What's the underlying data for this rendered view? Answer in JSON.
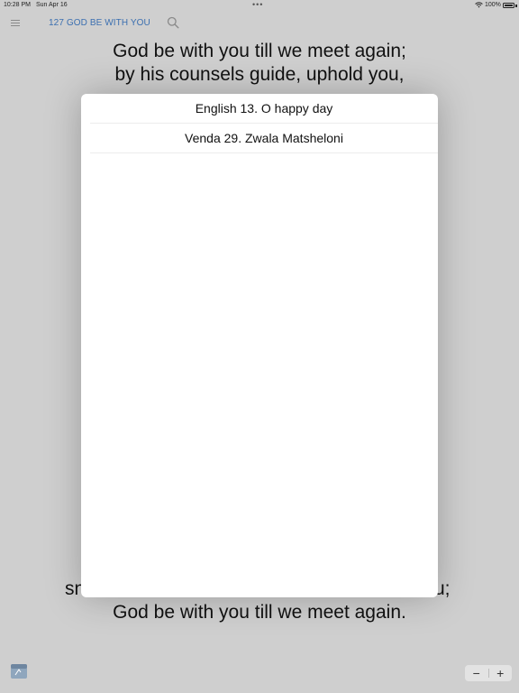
{
  "status": {
    "time": "10:28 PM",
    "date": "Sun Apr 16",
    "battery": "100%"
  },
  "nav": {
    "title": "127 GOD BE WITH YOU"
  },
  "hymn": {
    "top_lines": [
      "God be with you till we meet again;",
      "by his counsels guide, uphold you,"
    ],
    "bottom_partial_left": "sn",
    "bottom_partial_right": "u;",
    "bottom_last": "God be with you till we meet again."
  },
  "modal": {
    "items": [
      "English 13. O happy day",
      "Venda 29. Zwala Matsheloni"
    ]
  },
  "stepper": {
    "minus": "−",
    "plus": "+"
  },
  "colors": {
    "title_blue": "#3b6fb0",
    "background": "#cfcfcf"
  }
}
